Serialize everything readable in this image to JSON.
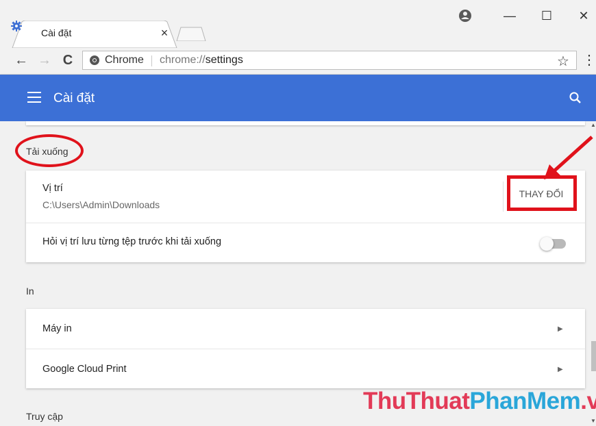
{
  "browser": {
    "tab_title": "Cài đặt",
    "tab_close": "×",
    "nav": {
      "back": "←",
      "forward": "→",
      "reload": "C"
    },
    "omnibox": {
      "chip_label": "Chrome",
      "url_prefix": "chrome://",
      "url_path": "settings"
    },
    "star": "☆",
    "menu": "⋮",
    "window_controls": {
      "minimize": "—",
      "maximize": "☐",
      "close": "✕"
    }
  },
  "app": {
    "title": "Cài đặt",
    "accent_color": "#3c70d6"
  },
  "sections": {
    "downloads": {
      "title": "Tải xuống",
      "location_label": "Vị trí",
      "location_value": "C:\\Users\\Admin\\Downloads",
      "change_button": "THAY ĐỔI",
      "ask_label": "Hỏi vị trí lưu từng tệp trước khi tải xuống",
      "ask_enabled": false
    },
    "printing": {
      "title": "In",
      "items": [
        "Máy in",
        "Google Cloud Print"
      ]
    },
    "accessibility": {
      "title": "Truy cập"
    }
  },
  "watermark": {
    "part1": "ThuThuat",
    "part2": "PhanMem",
    "part3": ".vn"
  },
  "icons": {
    "tab": "settings-gear-icon",
    "profile": "profile-icon",
    "search": "search-icon",
    "menu": "hamburger-menu-icon",
    "chrome": "chrome-logo-icon"
  }
}
